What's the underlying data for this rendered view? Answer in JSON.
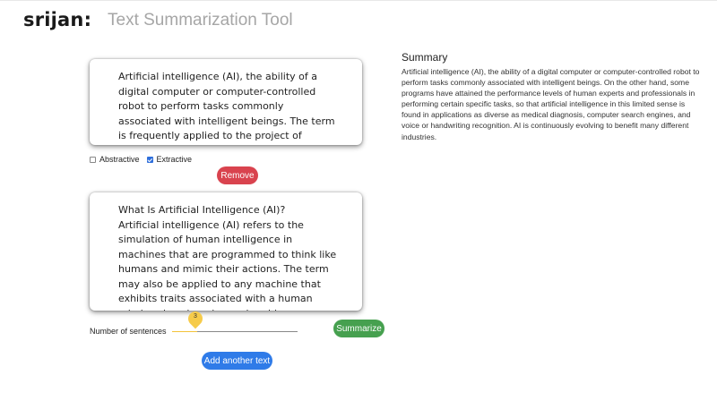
{
  "header": {
    "logo_text": "srijan:",
    "app_title": "Text Summarization Tool"
  },
  "inputs": [
    {
      "text": "Artificial intelligence (AI), the ability of a digital computer or computer-controlled robot to perform tasks commonly associated with intelligent beings. The term is frequently applied to the project of developing systems endowed with the intellectual"
    },
    {
      "text": "What Is Artificial Intelligence (AI)?\nArtificial intelligence (AI) refers to the simulation of human intelligence in machines that are programmed to think like humans and mimic their actions. The term may also be applied to any machine that exhibits traits associated with a human mind such as learning and problem-"
    }
  ],
  "modes": {
    "abstractive": {
      "label": "Abstractive",
      "checked": false
    },
    "extractive": {
      "label": "Extractive",
      "checked": true
    }
  },
  "buttons": {
    "remove": "Remove",
    "summarize": "Summarize",
    "add_another": "Add another text"
  },
  "sentences": {
    "label": "Number of sentences",
    "value": "3",
    "fraction": 0.2
  },
  "summary": {
    "heading": "Summary",
    "text": "Artificial intelligence (AI), the ability of a digital computer or computer-controlled robot to perform tasks commonly associated with intelligent beings. On the other hand, some programs have attained the performance levels of human experts and professionals in performing certain specific tasks, so that artificial intelligence in this limited sense is found in applications as diverse as medical diagnosis, computer search engines, and voice or handwriting recognition. AI is continuously evolving to benefit many different industries."
  },
  "colors": {
    "remove": "#d9434e",
    "summarize": "#46a04f",
    "add": "#2f7be8",
    "slider": "#f3c33a"
  }
}
